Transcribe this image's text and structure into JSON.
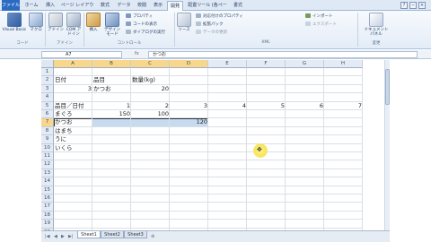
{
  "ribbon_tabs": [
    {
      "label": "ファイル",
      "state": "file"
    },
    {
      "label": "ホーム",
      "state": ""
    },
    {
      "label": "挿入",
      "state": ""
    },
    {
      "label": "ページ レイアウト",
      "state": ""
    },
    {
      "label": "数式",
      "state": ""
    },
    {
      "label": "データ",
      "state": ""
    },
    {
      "label": "校閲",
      "state": ""
    },
    {
      "label": "表示",
      "state": ""
    },
    {
      "label": "開発",
      "state": "active"
    },
    {
      "label": "配置ツール (各ページ)",
      "state": ""
    },
    {
      "label": "書式",
      "state": ""
    }
  ],
  "ribbon": {
    "vb_label": "Visual Basic",
    "macro_label": "マクロ",
    "addin_label": "アドイン",
    "com_addin_label": "COM アドイン",
    "insert_label": "挿入",
    "design_mode_label": "デザイン モード",
    "properties_label": "プロパティ",
    "view_code_label": "コードの表示",
    "run_dialog_label": "ダイアログの実行",
    "source_label": "ソース",
    "map_props_label": "対応付けのプロパティ",
    "expansion_pack_label": "拡張パック",
    "refresh_data_label": "データの更新",
    "import_label": "インポート",
    "export_label": "エクスポート",
    "doc_panel_label": "ドキュメント パネル",
    "group_code": "コード",
    "group_addins": "アドイン",
    "group_controls": "コントロール",
    "group_xml": "XML",
    "group_modify": "変更"
  },
  "formula_bar": {
    "name_box": "A7",
    "fx": "fx",
    "content": "かつお"
  },
  "columns": [
    "A",
    "B",
    "C",
    "D",
    "E",
    "F",
    "G",
    "H"
  ],
  "rows": [
    "1",
    "2",
    "3",
    "4",
    "5",
    "6",
    "7",
    "8",
    "9",
    "10",
    "11",
    "12",
    "13",
    "14",
    "15",
    "16",
    "17",
    "18",
    "19",
    "20"
  ],
  "cells": {
    "A2": "日付",
    "B2": "品目",
    "C2": "数量(kg)",
    "A3": "3",
    "B3": "かつお",
    "C3": "20",
    "A5": "品目／日付",
    "B5": "1",
    "C5": "2",
    "D5": "3",
    "E5": "4",
    "F5": "5",
    "G5": "6",
    "H5": "7",
    "A6": "まぐろ",
    "B6": "150",
    "C6": "100",
    "A7": "かつお",
    "D7": "120",
    "A8": "はまち",
    "A9": "うに",
    "A10": "いくら"
  },
  "sheet_tabs": [
    "Sheet1",
    "Sheet2",
    "Sheet3"
  ],
  "colors": {
    "selection_fill": "#c6dbf0",
    "header_selected": "#f8d78c",
    "cursor_highlight": "#f7e45c"
  }
}
